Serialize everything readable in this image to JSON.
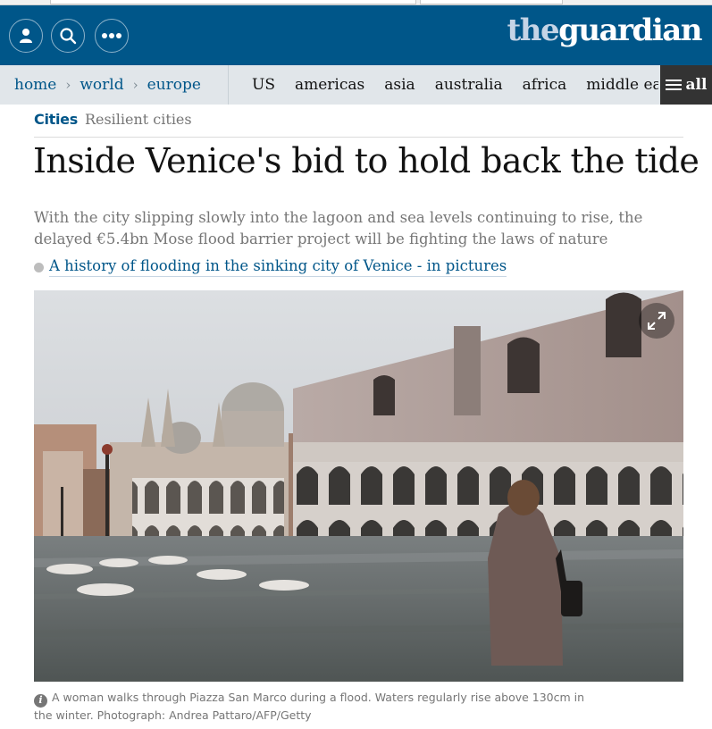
{
  "header": {
    "logo_the": "the",
    "logo_guardian": "guardian",
    "buttons": [
      {
        "icon": "profile-icon"
      },
      {
        "icon": "search-icon"
      },
      {
        "icon": "more-icon"
      }
    ],
    "brand_color": "#005689"
  },
  "nav": {
    "breadcrumb": [
      "home",
      "world",
      "europe"
    ],
    "editions": [
      "US",
      "americas",
      "asia",
      "australia",
      "africa",
      "middle eas"
    ],
    "all_label": "all"
  },
  "article": {
    "section": "Cities",
    "series": "Resilient cities",
    "headline": "Inside Venice's bid to hold back the tide",
    "standfirst": "With the city slipping slowly into the lagoon and sea levels continuing to rise, the delayed €5.4bn Mose flood barrier project will be fighting the laws of nature",
    "related_link": "A history of flooding in the sinking city of Venice - in pictures",
    "image": {
      "subject": "flooded Piazza San Marco with basilica and Doge's Palace",
      "expand_icon": "expand-icon"
    },
    "caption": "A woman walks through Piazza San Marco during a flood. Waters regularly rise above 130cm in the winter. Photograph: Andrea Pattaro/AFP/Getty"
  }
}
